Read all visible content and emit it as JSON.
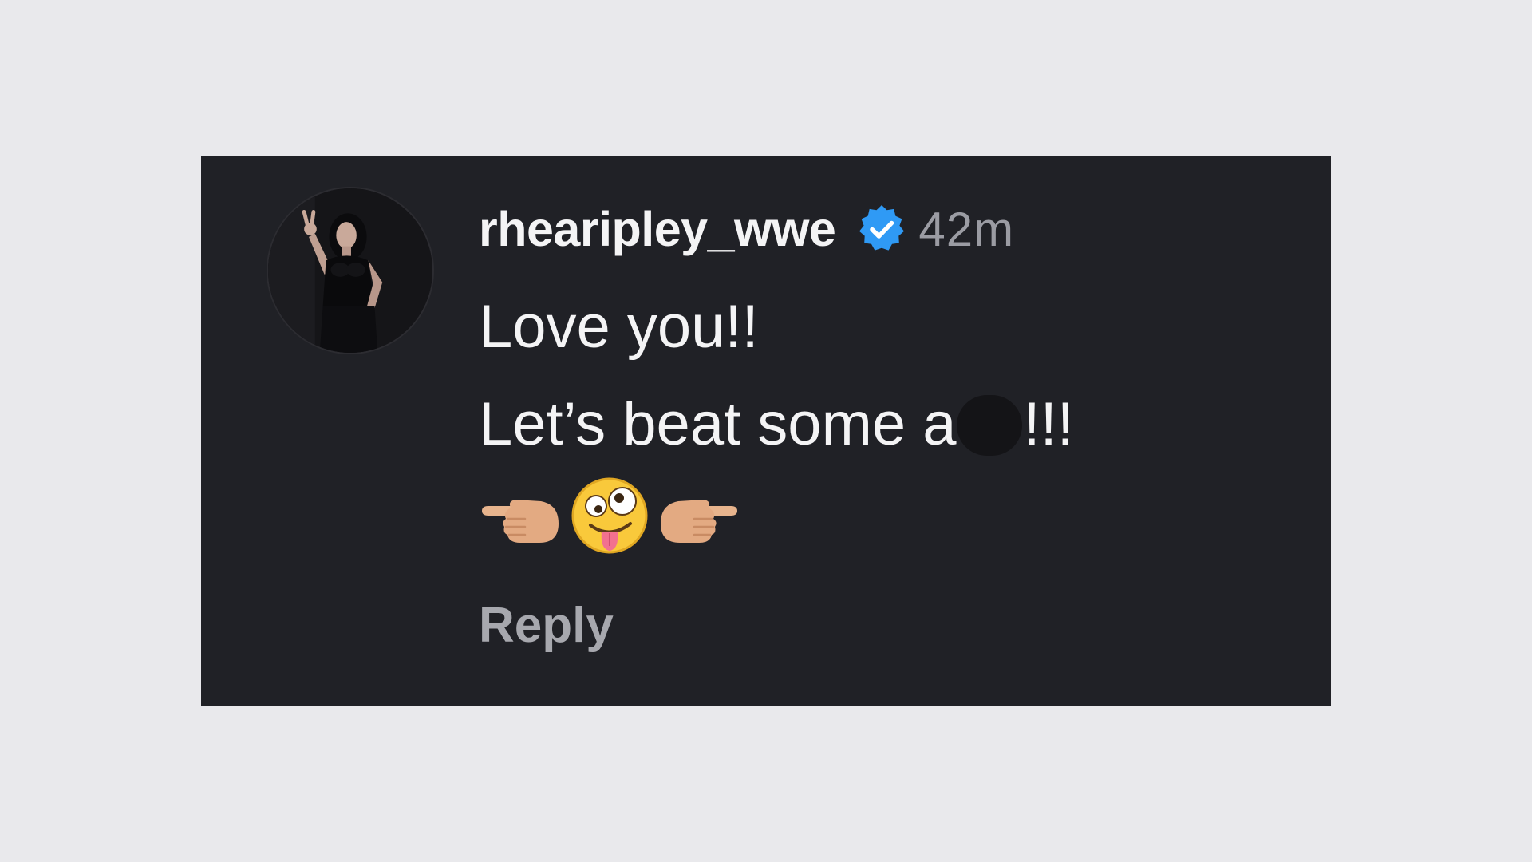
{
  "comment": {
    "username": "rhearipley_wwe",
    "timestamp": "42m",
    "text_line1": "Love you!!",
    "text_line2_start": "Let’s beat some a",
    "text_line2_end": "!!!",
    "emojis": [
      "backhand-index-pointing-left",
      "zany-face",
      "backhand-index-pointing-right"
    ],
    "reply_label": "Reply"
  },
  "icons": {
    "verified": "verified-badge-icon"
  },
  "colors": {
    "page_background": "#e9e9ec",
    "card_background": "#202126",
    "verified_blue": "#2f9af5",
    "muted_text": "#9b9ca3"
  }
}
